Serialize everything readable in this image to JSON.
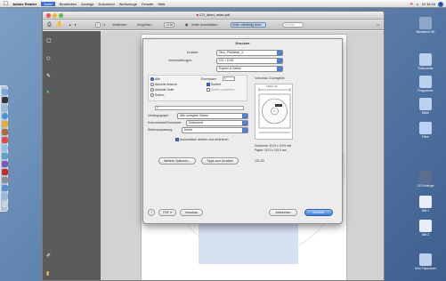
{
  "menubar": {
    "apple": "",
    "app": "Adobe Reader",
    "items": [
      "Datei",
      "Bearbeiten",
      "Anzeige",
      "Dokument",
      "Werkzeuge",
      "Fenster",
      "Hilfe"
    ],
    "clock": "Di 16:15"
  },
  "window": {
    "title": "CD_label_mtab.pdf",
    "toolbar": {
      "page": "1",
      "page_count": "/ 1",
      "zoom": "18,56",
      "zoom_label": "Vergrößern",
      "reduce_label": "Verkleinern",
      "find_label": "Seiten durchblättern",
      "fit_label": "Seite vollständig lesen",
      "search_placeholder": "Suchen"
    }
  },
  "print_dialog": {
    "title": "Drucken",
    "printer_label": "Drucker:",
    "printer_value": "Diso_Publisher_II",
    "presets_label": "Voreinstellungen:",
    "presets_value": "CD + DVD",
    "pane_value": "Kopien & Seiten",
    "copies_label": "Exemplare:",
    "copies_value": "1",
    "collated_label": "Sortiert",
    "reverse_label": "Seiten umkehren",
    "range_all": "Alle",
    "range_current_view": "Aktuelle Ansicht",
    "range_current_page": "Aktuelle Seite",
    "range_pages": "Seiten:",
    "range_pages_value": "1",
    "preview_title": "Vorschau: Zoomgerät",
    "preview_width": "119,9 mm",
    "page_scaling_label": "Umfangsgraph:",
    "page_scaling_value": "Alle vorlegten Seiten",
    "comments_label": "Kommentare/Formulare:",
    "comments_value": "Dokument",
    "scaling_label": "Seitenanpassung:",
    "scaling_value": "Keine",
    "autorotate_label": "Automatisch drehen und zentrieren",
    "doc_size": "Dokument: 119,9 x 119,9 mm",
    "paper_size": "Papier: 119,9 x 119,9 mm",
    "scale_percent": "121,00",
    "advanced_button": "Weitere Optionen...",
    "summary_button": "Tipps zum Drucken",
    "help_button": "?",
    "pdf_button": "PDF ▾",
    "preview_button": "Vorschau",
    "cancel_button": "Abbrechen",
    "print_button": "Drucken"
  },
  "desktop_icons": [
    {
      "name": "Macintosh HD",
      "color": "#8fa7c8"
    },
    {
      "name": "Dokumente",
      "color": "#bcd0ef"
    },
    {
      "name": "Programme",
      "color": "#bcd0ef"
    },
    {
      "name": "Bilder",
      "color": "#bcd0ef"
    },
    {
      "name": "Filme",
      "color": "#bcd0ef"
    },
    {
      "name": "CD-Rohlinge",
      "color": "#5c6e8d"
    },
    {
      "name": "Bild 1",
      "color": "#e8eef8"
    },
    {
      "name": "Bild 2",
      "color": "#e8eef8"
    },
    {
      "name": "Kein Fotoordner",
      "color": "#bcd0ef"
    }
  ],
  "colors": {
    "accent": "#3a6fd1",
    "sidebar": "#5b5b5b",
    "desktop": "#587ba8"
  }
}
